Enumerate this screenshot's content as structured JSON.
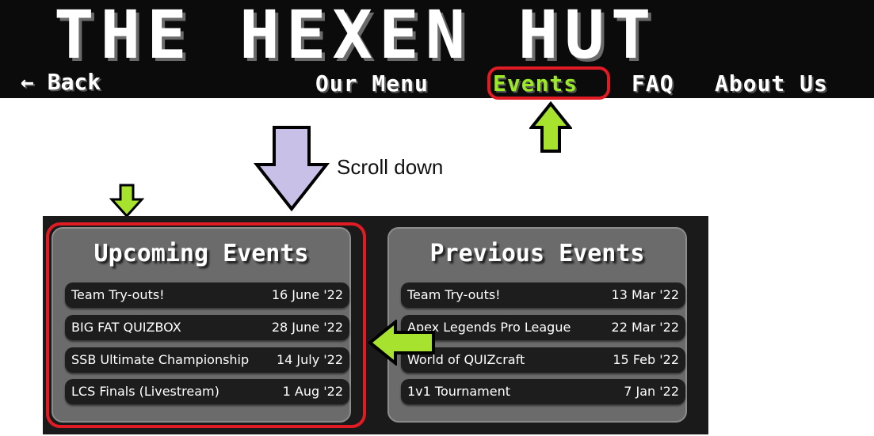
{
  "header": {
    "title": "THE HEXEN HUT",
    "back_label": "← Back",
    "nav": {
      "menu": "Our Menu",
      "events": "Events",
      "faq": "FAQ",
      "about": "About Us"
    }
  },
  "annotation": {
    "scroll_caption": "Scroll down"
  },
  "upcoming": {
    "title": "Upcoming Events",
    "items": [
      {
        "name": "Team Try-outs!",
        "date": "16 June '22"
      },
      {
        "name": "BIG FAT QUIZBOX",
        "date": "28 June '22"
      },
      {
        "name": "SSB Ultimate Championship",
        "date": "14 July '22"
      },
      {
        "name": "LCS Finals (Livestream)",
        "date": "1 Aug '22"
      }
    ]
  },
  "previous": {
    "title": "Previous Events",
    "items": [
      {
        "name": "Team Try-outs!",
        "date": "13 Mar '22"
      },
      {
        "name": "Apex Legends Pro League",
        "date": "22 Mar '22"
      },
      {
        "name": "World of QUIZcraft",
        "date": "15 Feb '22"
      },
      {
        "name": "1v1 Tournament",
        "date": "7 Jan '22"
      }
    ]
  },
  "colors": {
    "header_bg": "#0b0b0b",
    "active_nav": "#9bea26",
    "highlight_red": "#e01b24",
    "arrow_green": "#a6e22e",
    "arrow_lavender": "#c8c0e6",
    "panel_bg": "#6b6b6b",
    "row_bg": "#1d1d1d"
  }
}
